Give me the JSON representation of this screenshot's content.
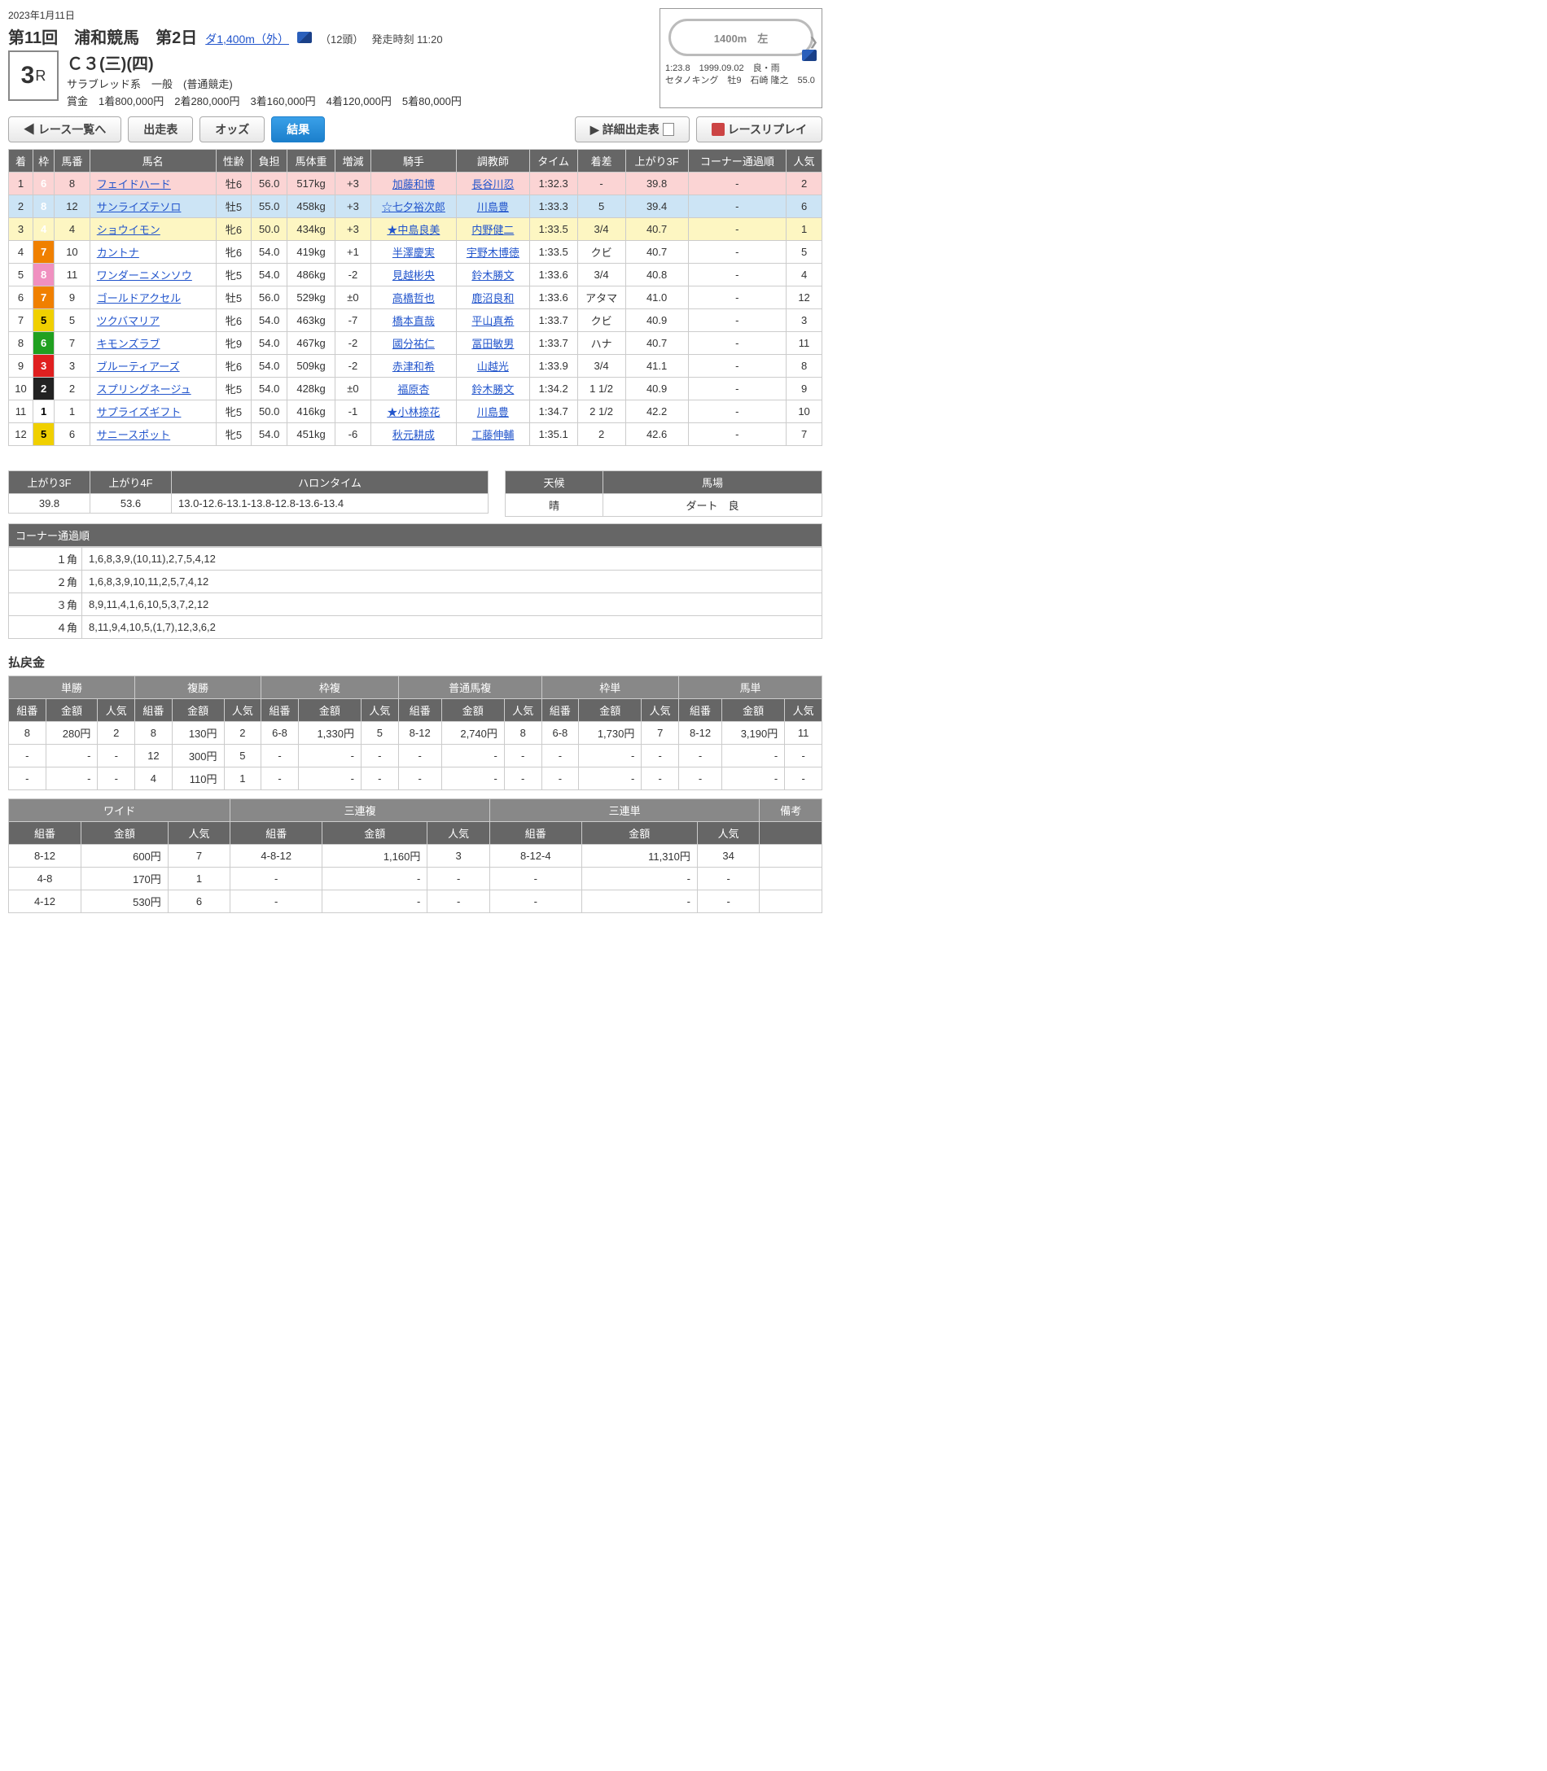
{
  "header": {
    "date": "2023年1月11日",
    "kaisai": "第11回　浦和競馬　第2日",
    "course_link": "ダ1,400m（外）",
    "heads": "（12頭）",
    "post_time": "発走時刻 11:20",
    "race_number": "3",
    "race_r": "R",
    "race_class": "Ｃ３(三)(四)",
    "race_type": "サラブレッド系　一般　(普通競走)",
    "race_prize": "賞金　1着800,000円　2着280,000円　3着160,000円　4着120,000円　5着80,000円",
    "track_label": "1400m　左",
    "track_record": "1:23.8　1999.09.02　良・雨",
    "track_record_horse": "セタノキング　牡9　石崎 隆之　55.0"
  },
  "nav": {
    "back": "レース一覧へ",
    "entries": "出走表",
    "odds": "オッズ",
    "results": "結果",
    "detail": "詳細出走表",
    "replay": "レースリプレイ"
  },
  "results_headers": [
    "着",
    "枠",
    "馬番",
    "馬名",
    "性齢",
    "負担",
    "馬体重",
    "増減",
    "騎手",
    "調教師",
    "タイム",
    "着差",
    "上がり3F",
    "コーナー通過順",
    "人気"
  ],
  "results": [
    {
      "rank": "1",
      "waku": "6",
      "num": "8",
      "horse": "フェイドハード",
      "sex": "牡6",
      "wt": "56.0",
      "bw": "517kg",
      "diff": "+3",
      "jockey": "加藤和博",
      "trainer": "長谷川忍",
      "time": "1:32.3",
      "margin": "-",
      "f3": "39.8",
      "corner": "-",
      "pop": "2"
    },
    {
      "rank": "2",
      "waku": "8",
      "num": "12",
      "horse": "サンライズテソロ",
      "sex": "牡5",
      "wt": "55.0",
      "bw": "458kg",
      "diff": "+3",
      "jockey": "☆七夕裕次郎",
      "trainer": "川島豊",
      "time": "1:33.3",
      "margin": "5",
      "f3": "39.4",
      "corner": "-",
      "pop": "6"
    },
    {
      "rank": "3",
      "waku": "4",
      "num": "4",
      "horse": "ショウイモン",
      "sex": "牝6",
      "wt": "50.0",
      "bw": "434kg",
      "diff": "+3",
      "jockey": "★中島良美",
      "trainer": "内野健二",
      "time": "1:33.5",
      "margin": "3/4",
      "f3": "40.7",
      "corner": "-",
      "pop": "1"
    },
    {
      "rank": "4",
      "waku": "7",
      "num": "10",
      "horse": "カントナ",
      "sex": "牝6",
      "wt": "54.0",
      "bw": "419kg",
      "diff": "+1",
      "jockey": "半澤慶実",
      "trainer": "宇野木博徳",
      "time": "1:33.5",
      "margin": "クビ",
      "f3": "40.7",
      "corner": "-",
      "pop": "5"
    },
    {
      "rank": "5",
      "waku": "8",
      "num": "11",
      "horse": "ワンダーニメンソウ",
      "sex": "牝5",
      "wt": "54.0",
      "bw": "486kg",
      "diff": "-2",
      "jockey": "見越彬央",
      "trainer": "鈴木勝文",
      "time": "1:33.6",
      "margin": "3/4",
      "f3": "40.8",
      "corner": "-",
      "pop": "4"
    },
    {
      "rank": "6",
      "waku": "7",
      "num": "9",
      "horse": "ゴールドアクセル",
      "sex": "牡5",
      "wt": "56.0",
      "bw": "529kg",
      "diff": "±0",
      "jockey": "高橋哲也",
      "trainer": "鹿沼良和",
      "time": "1:33.6",
      "margin": "アタマ",
      "f3": "41.0",
      "corner": "-",
      "pop": "12"
    },
    {
      "rank": "7",
      "waku": "5",
      "num": "5",
      "horse": "ツクバマリア",
      "sex": "牝6",
      "wt": "54.0",
      "bw": "463kg",
      "diff": "-7",
      "jockey": "橋本直哉",
      "trainer": "平山真希",
      "time": "1:33.7",
      "margin": "クビ",
      "f3": "40.9",
      "corner": "-",
      "pop": "3"
    },
    {
      "rank": "8",
      "waku": "6",
      "num": "7",
      "horse": "キモンズラブ",
      "sex": "牝9",
      "wt": "54.0",
      "bw": "467kg",
      "diff": "-2",
      "jockey": "國分祐仁",
      "trainer": "冨田敏男",
      "time": "1:33.7",
      "margin": "ハナ",
      "f3": "40.7",
      "corner": "-",
      "pop": "11"
    },
    {
      "rank": "9",
      "waku": "3",
      "num": "3",
      "horse": "ブルーティアーズ",
      "sex": "牝6",
      "wt": "54.0",
      "bw": "509kg",
      "diff": "-2",
      "jockey": "赤津和希",
      "trainer": "山越光",
      "time": "1:33.9",
      "margin": "3/4",
      "f3": "41.1",
      "corner": "-",
      "pop": "8"
    },
    {
      "rank": "10",
      "waku": "2",
      "num": "2",
      "horse": "スプリングネージュ",
      "sex": "牝5",
      "wt": "54.0",
      "bw": "428kg",
      "diff": "±0",
      "jockey": "福原杏",
      "trainer": "鈴木勝文",
      "time": "1:34.2",
      "margin": "1 1/2",
      "f3": "40.9",
      "corner": "-",
      "pop": "9"
    },
    {
      "rank": "11",
      "waku": "1",
      "num": "1",
      "horse": "サプライズギフト",
      "sex": "牝5",
      "wt": "50.0",
      "bw": "416kg",
      "diff": "-1",
      "jockey": "★小林捺花",
      "trainer": "川島豊",
      "time": "1:34.7",
      "margin": "2 1/2",
      "f3": "42.2",
      "corner": "-",
      "pop": "10"
    },
    {
      "rank": "12",
      "waku": "5",
      "num": "6",
      "horse": "サニースポット",
      "sex": "牝5",
      "wt": "54.0",
      "bw": "451kg",
      "diff": "-6",
      "jockey": "秋元耕成",
      "trainer": "工藤伸輔",
      "time": "1:35.1",
      "margin": "2",
      "f3": "42.6",
      "corner": "-",
      "pop": "7"
    }
  ],
  "lap": {
    "headers": [
      "上がり3F",
      "上がり4F",
      "ハロンタイム"
    ],
    "f3": "39.8",
    "f4": "53.6",
    "haron": "13.0-12.6-13.1-13.8-12.8-13.6-13.4"
  },
  "cond": {
    "headers": [
      "天候",
      "馬場"
    ],
    "weather": "晴",
    "going": "ダート　良"
  },
  "corners": {
    "title": "コーナー通過順",
    "rows": [
      {
        "label": "１角",
        "order": "1,6,8,3,9,(10,11),2,7,5,4,12"
      },
      {
        "label": "２角",
        "order": "1,6,8,3,9,10,11,2,5,7,4,12"
      },
      {
        "label": "３角",
        "order": "8,9,11,4,1,6,10,5,3,7,2,12"
      },
      {
        "label": "４角",
        "order": "8,11,9,4,10,5,(1,7),12,3,6,2"
      }
    ]
  },
  "payout_title": "払戻金",
  "payout_headers": {
    "combo": "組番",
    "amount": "金額",
    "pop": "人気"
  },
  "payout1": {
    "cats": [
      "単勝",
      "複勝",
      "枠複",
      "普通馬複",
      "枠単",
      "馬単"
    ],
    "rows": [
      [
        {
          "c": "8",
          "a": "280円",
          "p": "2"
        },
        {
          "c": "8",
          "a": "130円",
          "p": "2"
        },
        {
          "c": "6-8",
          "a": "1,330円",
          "p": "5"
        },
        {
          "c": "8-12",
          "a": "2,740円",
          "p": "8"
        },
        {
          "c": "6-8",
          "a": "1,730円",
          "p": "7"
        },
        {
          "c": "8-12",
          "a": "3,190円",
          "p": "11"
        }
      ],
      [
        {
          "c": "-",
          "a": "-",
          "p": "-"
        },
        {
          "c": "12",
          "a": "300円",
          "p": "5"
        },
        {
          "c": "-",
          "a": "-",
          "p": "-"
        },
        {
          "c": "-",
          "a": "-",
          "p": "-"
        },
        {
          "c": "-",
          "a": "-",
          "p": "-"
        },
        {
          "c": "-",
          "a": "-",
          "p": "-"
        }
      ],
      [
        {
          "c": "-",
          "a": "-",
          "p": "-"
        },
        {
          "c": "4",
          "a": "110円",
          "p": "1"
        },
        {
          "c": "-",
          "a": "-",
          "p": "-"
        },
        {
          "c": "-",
          "a": "-",
          "p": "-"
        },
        {
          "c": "-",
          "a": "-",
          "p": "-"
        },
        {
          "c": "-",
          "a": "-",
          "p": "-"
        }
      ]
    ]
  },
  "payout2": {
    "cats": [
      "ワイド",
      "三連複",
      "三連単",
      "備考"
    ],
    "rows": [
      [
        {
          "c": "8-12",
          "a": "600円",
          "p": "7"
        },
        {
          "c": "4-8-12",
          "a": "1,160円",
          "p": "3"
        },
        {
          "c": "8-12-4",
          "a": "11,310円",
          "p": "34"
        },
        {
          "note": ""
        }
      ],
      [
        {
          "c": "4-8",
          "a": "170円",
          "p": "1"
        },
        {
          "c": "-",
          "a": "-",
          "p": "-"
        },
        {
          "c": "-",
          "a": "-",
          "p": "-"
        },
        {
          "note": ""
        }
      ],
      [
        {
          "c": "4-12",
          "a": "530円",
          "p": "6"
        },
        {
          "c": "-",
          "a": "-",
          "p": "-"
        },
        {
          "c": "-",
          "a": "-",
          "p": "-"
        },
        {
          "note": ""
        }
      ]
    ]
  }
}
